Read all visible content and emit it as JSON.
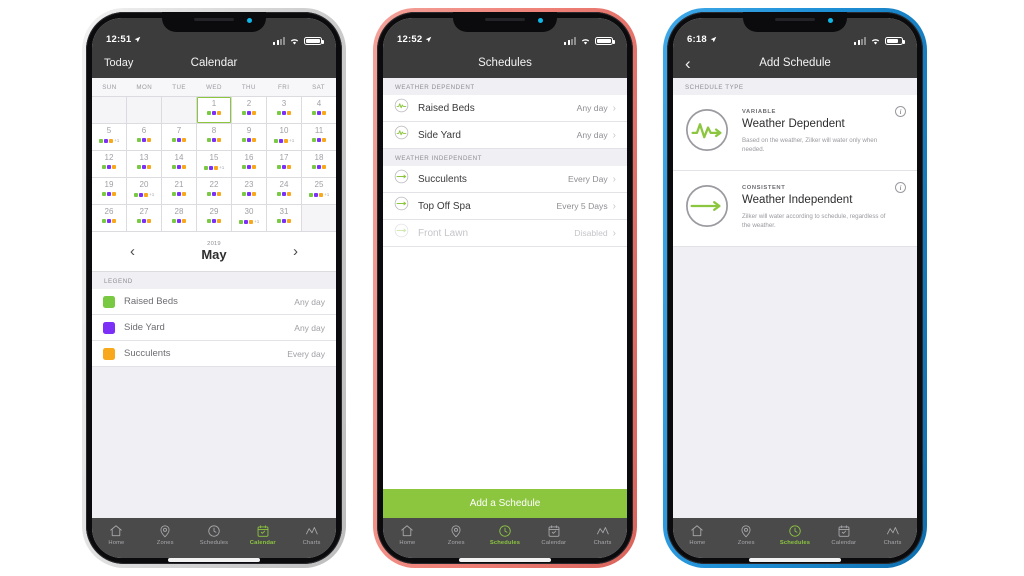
{
  "accent_green": "#8cc63f",
  "colors": {
    "raised_beds": "#7ac943",
    "side_yard": "#7b2ff7",
    "succulents": "#f7a81b"
  },
  "phone1": {
    "frame": "silver",
    "status": {
      "time": "12:51"
    },
    "nav": {
      "left": "Today",
      "title": "Calendar"
    },
    "calendar": {
      "dow": [
        "SUN",
        "MON",
        "TUE",
        "WED",
        "THU",
        "FRI",
        "SAT"
      ],
      "lead_blanks": 3,
      "today": 1,
      "days": [
        {
          "n": 1,
          "dots": [
            "g",
            "p",
            "o"
          ],
          "plus": ""
        },
        {
          "n": 2,
          "dots": [
            "g",
            "p",
            "o"
          ],
          "plus": ""
        },
        {
          "n": 3,
          "dots": [
            "g",
            "p",
            "o"
          ],
          "plus": ""
        },
        {
          "n": 4,
          "dots": [
            "g",
            "p",
            "o"
          ],
          "plus": ""
        },
        {
          "n": 5,
          "dots": [
            "g",
            "p",
            "o"
          ],
          "plus": "+1"
        },
        {
          "n": 6,
          "dots": [
            "g",
            "p",
            "o"
          ],
          "plus": ""
        },
        {
          "n": 7,
          "dots": [
            "g",
            "p",
            "o"
          ],
          "plus": ""
        },
        {
          "n": 8,
          "dots": [
            "g",
            "p",
            "o"
          ],
          "plus": ""
        },
        {
          "n": 9,
          "dots": [
            "g",
            "p",
            "o"
          ],
          "plus": ""
        },
        {
          "n": 10,
          "dots": [
            "g",
            "p",
            "o"
          ],
          "plus": "+1"
        },
        {
          "n": 11,
          "dots": [
            "g",
            "p",
            "o"
          ],
          "plus": ""
        },
        {
          "n": 12,
          "dots": [
            "g",
            "p",
            "o"
          ],
          "plus": ""
        },
        {
          "n": 13,
          "dots": [
            "g",
            "p",
            "o"
          ],
          "plus": ""
        },
        {
          "n": 14,
          "dots": [
            "g",
            "p",
            "o"
          ],
          "plus": ""
        },
        {
          "n": 15,
          "dots": [
            "g",
            "p",
            "o"
          ],
          "plus": "+1"
        },
        {
          "n": 16,
          "dots": [
            "g",
            "p",
            "o"
          ],
          "plus": ""
        },
        {
          "n": 17,
          "dots": [
            "g",
            "p",
            "o"
          ],
          "plus": ""
        },
        {
          "n": 18,
          "dots": [
            "g",
            "p",
            "o"
          ],
          "plus": ""
        },
        {
          "n": 19,
          "dots": [
            "g",
            "p",
            "o"
          ],
          "plus": ""
        },
        {
          "n": 20,
          "dots": [
            "g",
            "p",
            "o"
          ],
          "plus": "+1"
        },
        {
          "n": 21,
          "dots": [
            "g",
            "p",
            "o"
          ],
          "plus": ""
        },
        {
          "n": 22,
          "dots": [
            "g",
            "p",
            "o"
          ],
          "plus": ""
        },
        {
          "n": 23,
          "dots": [
            "g",
            "p",
            "o"
          ],
          "plus": ""
        },
        {
          "n": 24,
          "dots": [
            "g",
            "p",
            "o"
          ],
          "plus": ""
        },
        {
          "n": 25,
          "dots": [
            "g",
            "p",
            "o"
          ],
          "plus": "+1"
        },
        {
          "n": 26,
          "dots": [
            "g",
            "p",
            "o"
          ],
          "plus": ""
        },
        {
          "n": 27,
          "dots": [
            "g",
            "p",
            "o"
          ],
          "plus": ""
        },
        {
          "n": 28,
          "dots": [
            "g",
            "p",
            "o"
          ],
          "plus": ""
        },
        {
          "n": 29,
          "dots": [
            "g",
            "p",
            "o"
          ],
          "plus": ""
        },
        {
          "n": 30,
          "dots": [
            "g",
            "p",
            "o"
          ],
          "plus": "+1"
        },
        {
          "n": 31,
          "dots": [
            "g",
            "p",
            "o"
          ],
          "plus": ""
        }
      ]
    },
    "monthnav": {
      "prev": "‹",
      "next": "›",
      "year": "2019",
      "month": "May"
    },
    "legend": {
      "header": "LEGEND",
      "items": [
        {
          "label": "Raised Beds",
          "value": "Any day",
          "color": "#7ac943"
        },
        {
          "label": "Side Yard",
          "value": "Any day",
          "color": "#7b2ff7"
        },
        {
          "label": "Succulents",
          "value": "Every day",
          "color": "#f7a81b"
        }
      ]
    },
    "tabs": [
      {
        "label": "Home",
        "icon": "home-icon",
        "active": false
      },
      {
        "label": "Zones",
        "icon": "pin-icon",
        "active": false
      },
      {
        "label": "Schedules",
        "icon": "clock-icon",
        "active": false
      },
      {
        "label": "Calendar",
        "icon": "calendar-icon",
        "active": true
      },
      {
        "label": "Charts",
        "icon": "chart-icon",
        "active": false
      }
    ]
  },
  "phone2": {
    "frame": "coral",
    "status": {
      "time": "12:52"
    },
    "nav": {
      "title": "Schedules"
    },
    "sections": [
      {
        "header": "WEATHER DEPENDENT",
        "rows": [
          {
            "label": "Raised Beds",
            "value": "Any day",
            "icon": "wave-circle-icon",
            "disabled": false
          },
          {
            "label": "Side Yard",
            "value": "Any day",
            "icon": "wave-circle-icon",
            "disabled": false
          }
        ]
      },
      {
        "header": "WEATHER INDEPENDENT",
        "rows": [
          {
            "label": "Succulents",
            "value": "Every Day",
            "icon": "line-circle-icon",
            "disabled": false
          },
          {
            "label": "Top Off Spa",
            "value": "Every 5 Days",
            "icon": "line-circle-icon",
            "disabled": false
          },
          {
            "label": "Front Lawn",
            "value": "Disabled",
            "icon": "line-circle-icon",
            "disabled": true
          }
        ]
      }
    ],
    "add_button": "Add a Schedule",
    "tabs": [
      {
        "label": "Home",
        "icon": "home-icon",
        "active": false
      },
      {
        "label": "Zones",
        "icon": "pin-icon",
        "active": false
      },
      {
        "label": "Schedules",
        "icon": "clock-icon",
        "active": true
      },
      {
        "label": "Calendar",
        "icon": "calendar-icon",
        "active": false
      },
      {
        "label": "Charts",
        "icon": "chart-icon",
        "active": false
      }
    ]
  },
  "phone3": {
    "frame": "blue",
    "status": {
      "time": "6:18"
    },
    "nav": {
      "back": "‹",
      "title": "Add Schedule"
    },
    "section_header": "SCHEDULE TYPE",
    "cards": [
      {
        "kicker": "VARIABLE",
        "title": "Weather Dependent",
        "desc": "Based on the weather, Zilker will water only when needed.",
        "icon": "waveform-arrow-circle-icon",
        "info": "i"
      },
      {
        "kicker": "CONSISTENT",
        "title": "Weather Independent",
        "desc": "Zilker will water according to schedule, regardless of the weather.",
        "icon": "straight-arrow-circle-icon",
        "info": "i"
      }
    ],
    "tabs": [
      {
        "label": "Home",
        "icon": "home-icon",
        "active": false
      },
      {
        "label": "Zones",
        "icon": "pin-icon",
        "active": false
      },
      {
        "label": "Schedules",
        "icon": "clock-icon",
        "active": true
      },
      {
        "label": "Calendar",
        "icon": "calendar-icon",
        "active": false
      },
      {
        "label": "Charts",
        "icon": "chart-icon",
        "active": false
      }
    ]
  }
}
